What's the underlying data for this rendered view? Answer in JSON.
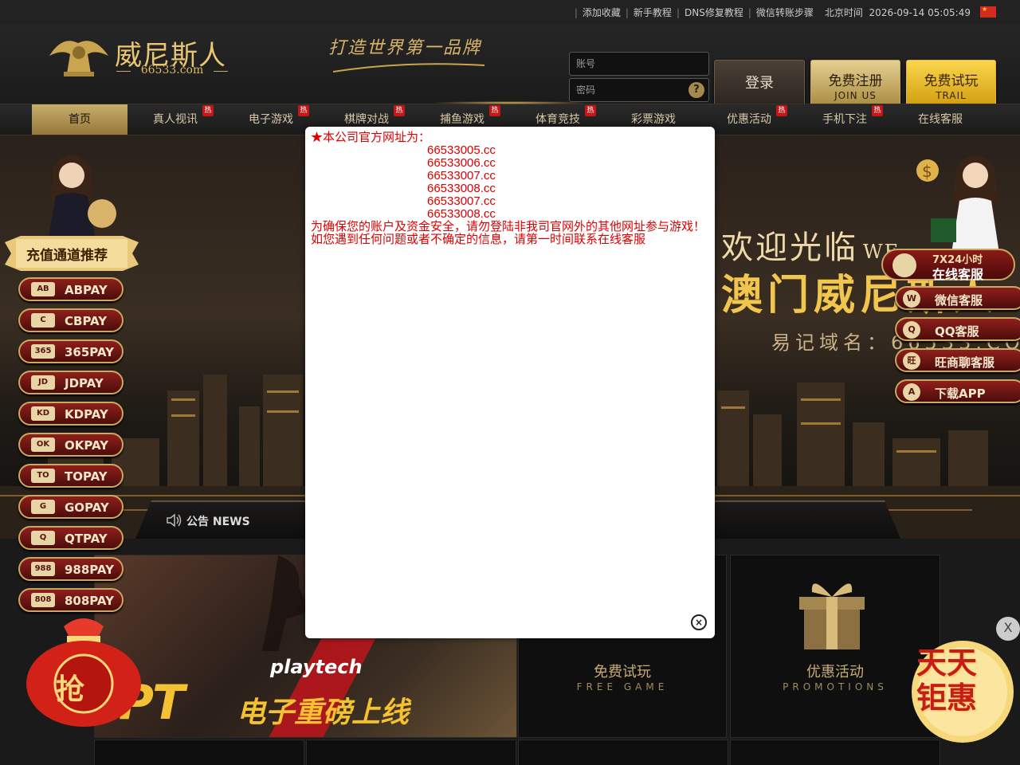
{
  "topbar": {
    "links": [
      "添加收藏",
      "新手教程",
      "DNS修复教程",
      "微信转账步骤"
    ],
    "clock_label": "北京时间",
    "clock_value": "2026-09-14 05:05:49",
    "flag_icon": "china-flag-icon"
  },
  "header": {
    "logo_name": "威尼斯人",
    "logo_domain": "66533.com",
    "slogan": "打造世界第一品牌",
    "account_placeholder": "账号",
    "password_placeholder": "密码",
    "help_label": "?",
    "login_label": "登录",
    "join_cn": "免费注册",
    "join_en": "JOIN US",
    "trail_cn": "免费试玩",
    "trail_en": "TRAIL"
  },
  "nav": {
    "items": [
      {
        "label": "首页",
        "hot": false,
        "active": true
      },
      {
        "label": "真人视讯",
        "hot": true
      },
      {
        "label": "电子游戏",
        "hot": true
      },
      {
        "label": "棋牌对战",
        "hot": true
      },
      {
        "label": "捕鱼游戏",
        "hot": true
      },
      {
        "label": "体育竞技",
        "hot": true
      },
      {
        "label": "彩票游戏",
        "hot": false
      },
      {
        "label": "优惠活动",
        "hot": true
      },
      {
        "label": "手机下注",
        "hot": true
      },
      {
        "label": "在线客服",
        "hot": false
      }
    ],
    "hot_badge": "热"
  },
  "banner": {
    "welcome": "欢迎光临",
    "welcome_en": "WE",
    "macau": "澳门威尼斯人",
    "easy_domain": "易记域名：66533.COM",
    "news_label": "公告 NEWS"
  },
  "left_sidebar": {
    "title": "充值通道推荐",
    "payments": [
      {
        "label": "ABPAY",
        "logo": "AB"
      },
      {
        "label": "CBPAY",
        "logo": "C"
      },
      {
        "label": "365PAY",
        "logo": "365"
      },
      {
        "label": "JDPAY",
        "logo": "JD"
      },
      {
        "label": "KDPAY",
        "logo": "KD"
      },
      {
        "label": "OKPAY",
        "logo": "OK"
      },
      {
        "label": "TOPAY",
        "logo": "TO"
      },
      {
        "label": "GOPAY",
        "logo": "G"
      },
      {
        "label": "QTPAY",
        "logo": "Q"
      },
      {
        "label": "988PAY",
        "logo": "988"
      },
      {
        "label": "808PAY",
        "logo": "808"
      }
    ],
    "lucky_bag_label": "抢"
  },
  "right_sidebar": {
    "service_24": "7X24小时",
    "service_online": "在线客服",
    "items": [
      {
        "label": "微信客服",
        "icon": "wechat-icon"
      },
      {
        "label": "QQ客服",
        "icon": "qq-icon"
      },
      {
        "label": "旺商聊客服",
        "icon": "wangshang-icon"
      },
      {
        "label": "下载APP",
        "icon": "download-icon"
      }
    ],
    "daily_promo": "天天钜惠",
    "daily_close": "X"
  },
  "tiles": {
    "pt_brand": "playtech",
    "pt_big": "PT",
    "pt_title": "电子重磅上线",
    "free_game_cn": "免费试玩",
    "free_game_en": "FREE GAME",
    "promo_cn": "优惠活动",
    "promo_en": "PROMOTIONS"
  },
  "modal": {
    "heading": "★本公司官方网址为：",
    "urls": [
      "66533005.cc",
      "66533006.cc",
      "66533007.cc",
      "66533008.cc",
      "66533007.cc",
      "66533008.cc"
    ],
    "warning": "为确保您的账户及资金安全，请勿登陆非我司官网外的其他网址参与游戏！如您遇到任何问题或者不确定的信息，请第一时间联系在线客服",
    "close_label": "×"
  },
  "colors": {
    "gold": "#c9a862",
    "red_text": "#e00000",
    "nav_active": "#c9ad6a"
  }
}
